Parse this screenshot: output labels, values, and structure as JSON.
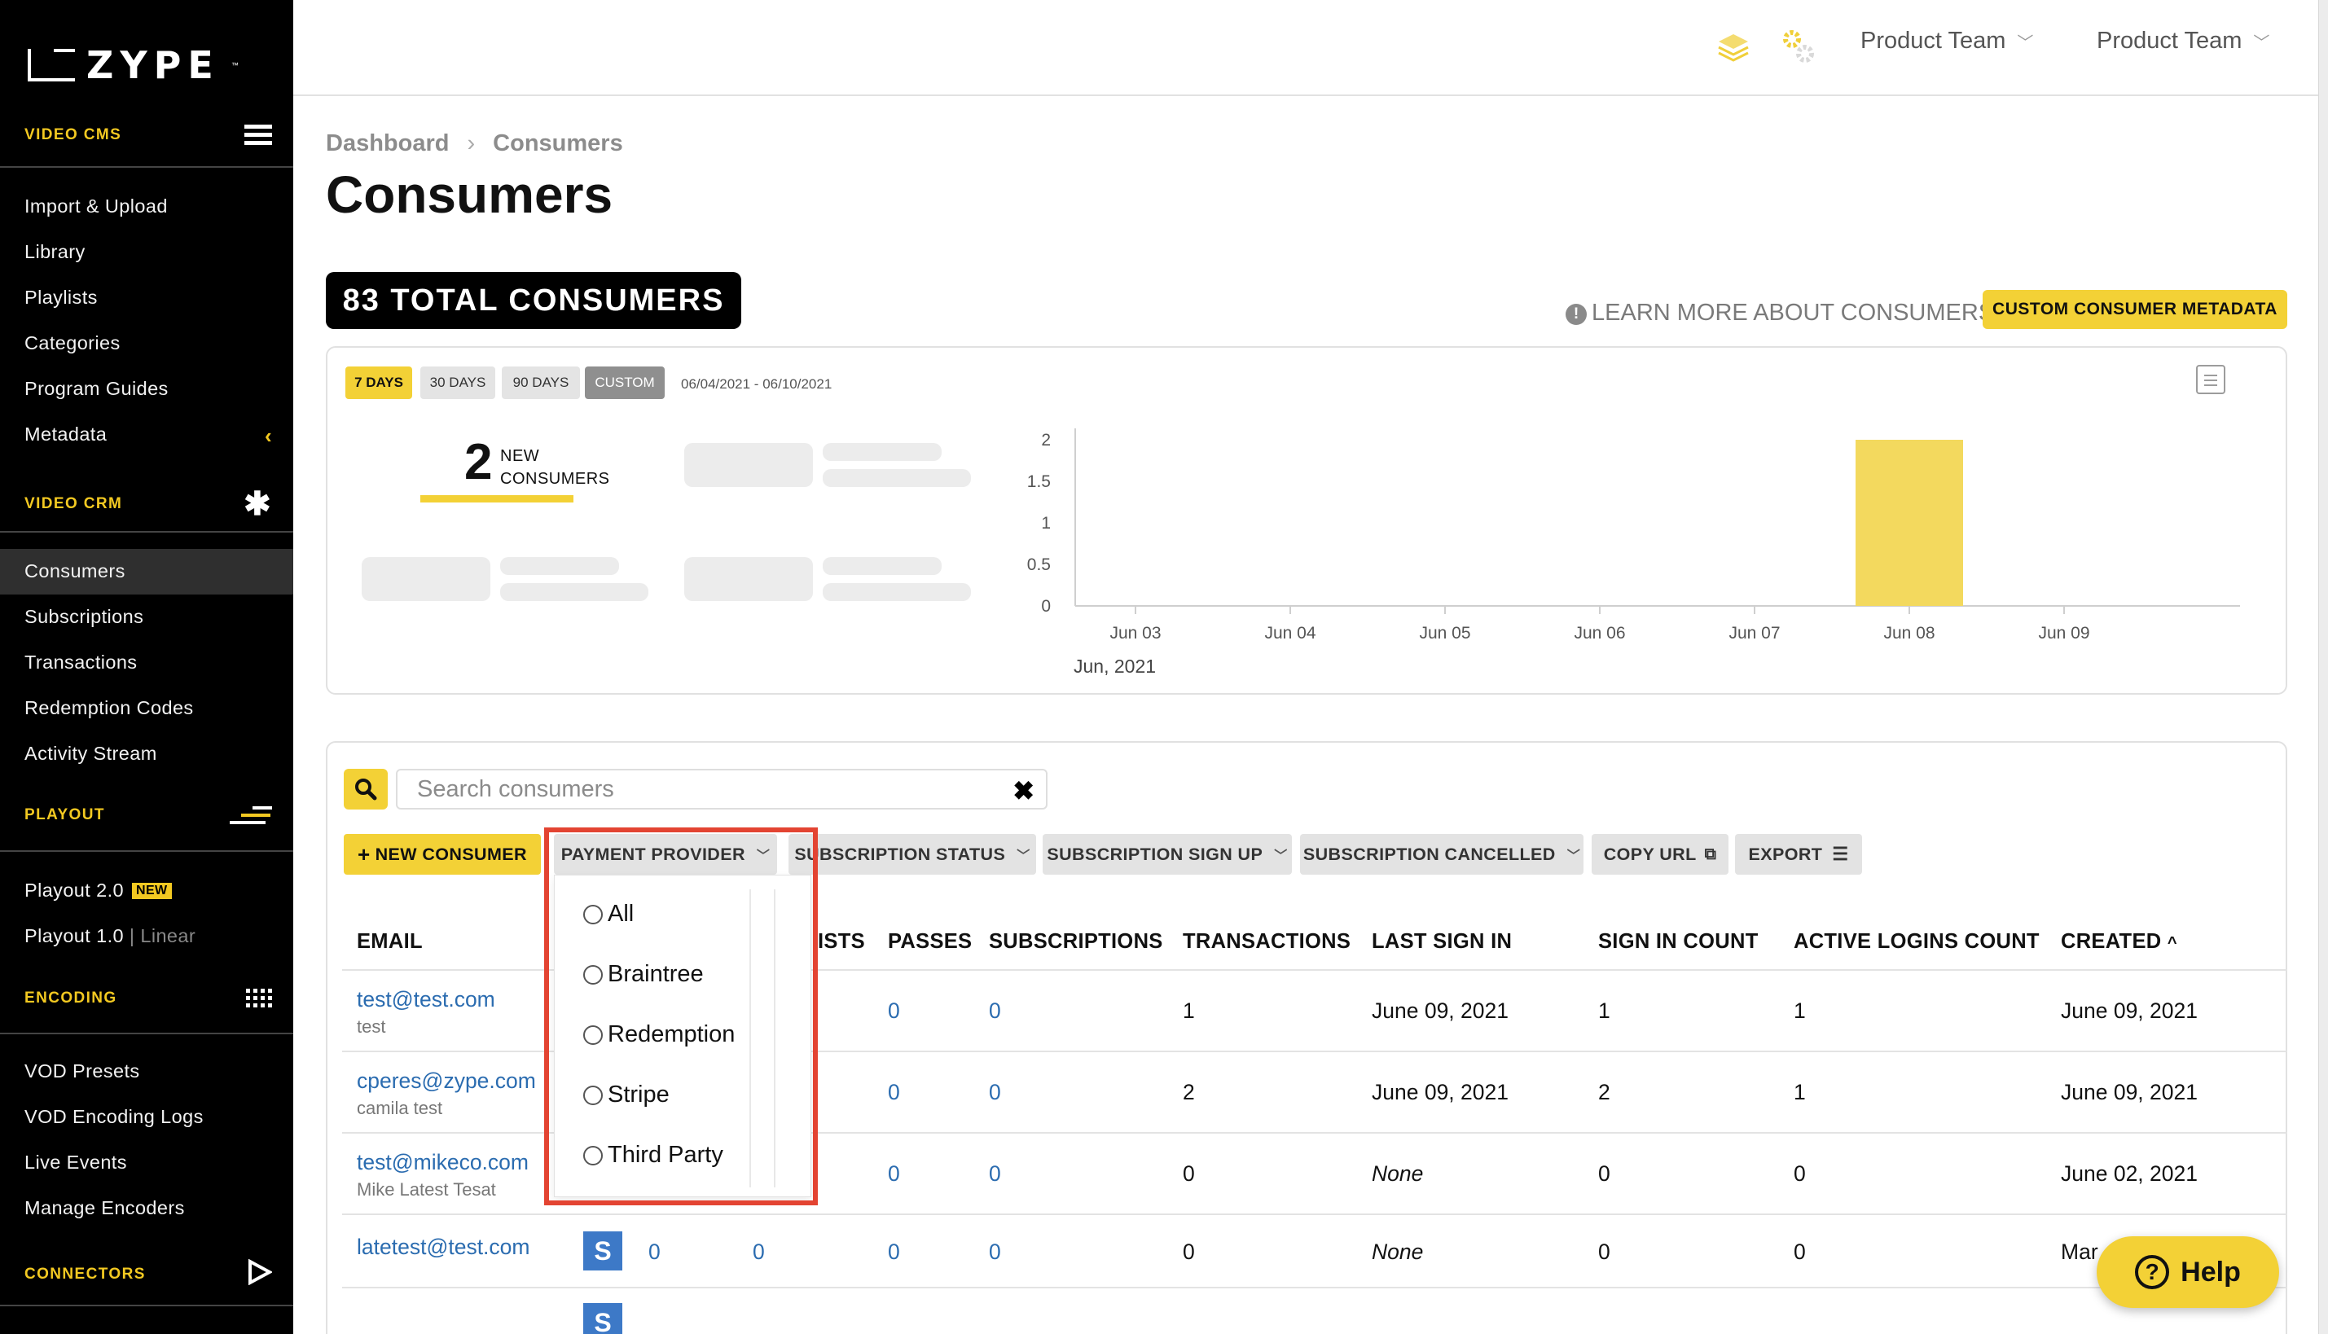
{
  "brand": {
    "logo_text": "ZYPE",
    "tm": "™"
  },
  "sidebar": {
    "sections": {
      "video_cms": "VIDEO CMS",
      "video_crm": "VIDEO CRM",
      "playout": "PLAYOUT",
      "encoding": "ENCODING",
      "connectors": "CONNECTORS"
    },
    "video_cms_items": [
      "Import & Upload",
      "Library",
      "Playlists",
      "Categories",
      "Program Guides",
      "Metadata"
    ],
    "video_crm_items": [
      "Consumers",
      "Subscriptions",
      "Transactions",
      "Redemption Codes",
      "Activity Stream"
    ],
    "playout_items": {
      "playout2": "Playout 2.0",
      "new_badge": "NEW",
      "playout1": "Playout 1.0",
      "separator": "|",
      "linear": "Linear"
    },
    "encoding_items": [
      "VOD Presets",
      "VOD Encoding Logs",
      "Live Events",
      "Manage Encoders"
    ],
    "active_item": "Consumers"
  },
  "topbar": {
    "team1": "Product Team",
    "team2": "Product Team"
  },
  "breadcrumb": {
    "root": "Dashboard",
    "sep": "›",
    "current": "Consumers"
  },
  "page": {
    "title": "Consumers",
    "total": "83 TOTAL CONSUMERS",
    "learn_more": "LEARN MORE ABOUT CONSUMERS",
    "custom_meta": "CUSTOM CONSUMER METADATA"
  },
  "stats": {
    "ranges": [
      "7 DAYS",
      "30 DAYS",
      "90 DAYS",
      "CUSTOM"
    ],
    "active_range": "7 DAYS",
    "date_range": "06/04/2021 - 06/10/2021",
    "kpi_value": "2",
    "kpi_label_1": "NEW",
    "kpi_label_2": "CONSUMERS"
  },
  "chart_data": {
    "type": "bar",
    "categories": [
      "Jun 03",
      "Jun 04",
      "Jun 05",
      "Jun 06",
      "Jun 07",
      "Jun 08",
      "Jun 09"
    ],
    "values": [
      0,
      0,
      0,
      0,
      0,
      2,
      0
    ],
    "yticks": [
      "0",
      "0.5",
      "1",
      "1.5",
      "2"
    ],
    "ylim": [
      0,
      2
    ],
    "xlabel": "Jun, 2021",
    "bar_color": "#f3d95e",
    "grid": false
  },
  "search": {
    "placeholder": "Search consumers",
    "clear": "✖"
  },
  "filters": {
    "new_consumer": "NEW CONSUMER",
    "payment_provider": "PAYMENT PROVIDER",
    "subscription_status": "SUBSCRIPTION STATUS",
    "subscription_signup": "SUBSCRIPTION SIGN UP",
    "subscription_cancelled": "SUBSCRIPTION CANCELLED",
    "copy_url": "COPY URL",
    "export": "EXPORT"
  },
  "payment_provider_options": [
    "All",
    "Braintree",
    "Redemption",
    "Stripe",
    "Third Party"
  ],
  "table": {
    "headers": {
      "email": "EMAIL",
      "lists_partial": "ISTS",
      "passes": "PASSES",
      "subscriptions": "SUBSCRIPTIONS",
      "transactions": "TRANSACTIONS",
      "last_sign_in": "LAST SIGN IN",
      "sign_in_count": "SIGN IN COUNT",
      "active_logins": "ACTIVE LOGINS COUNT",
      "created": "CREATED",
      "sort_icon": "^"
    },
    "rows": [
      {
        "email": "test@test.com",
        "name": "test",
        "col_a": "",
        "col_b": "",
        "lists": "",
        "passes": "0",
        "subscriptions": "0",
        "transactions": "1",
        "last_sign_in": "June 09, 2021",
        "sign_in_count": "1",
        "active_logins": "1",
        "created": "June 09, 2021"
      },
      {
        "email": "cperes@zype.com",
        "name": "camila test",
        "col_a": "",
        "col_b": "",
        "lists": "",
        "passes": "0",
        "subscriptions": "0",
        "transactions": "2",
        "last_sign_in": "June 09, 2021",
        "sign_in_count": "2",
        "active_logins": "1",
        "created": "June 09, 2021"
      },
      {
        "email": "test@mikeco.com",
        "name": "Mike Latest Tesat",
        "col_a": "",
        "col_b": "",
        "lists": "",
        "passes": "0",
        "subscriptions": "0",
        "transactions": "0",
        "last_sign_in": "None",
        "sign_in_count": "0",
        "active_logins": "0",
        "created": "June 02, 2021"
      },
      {
        "email": "latetest@test.com",
        "name": "",
        "stripe": "S",
        "col_a": "0",
        "col_b": "0",
        "lists": "",
        "passes": "0",
        "subscriptions": "0",
        "transactions": "0",
        "last_sign_in": "None",
        "sign_in_count": "0",
        "active_logins": "0",
        "created": "Mar"
      },
      {
        "stripe": "S"
      }
    ]
  },
  "help": {
    "label": "Help",
    "icon": "?"
  }
}
